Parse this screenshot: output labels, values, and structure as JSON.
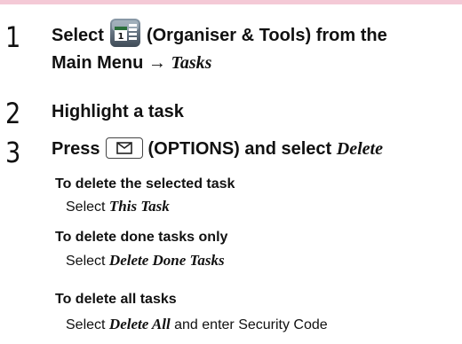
{
  "steps": [
    {
      "number": "1",
      "line1_before": "Select",
      "line1_after": "(Organiser & Tools) from the",
      "line2_prefix": "Main Menu → ",
      "line2_italic": "Tasks"
    },
    {
      "number": "2",
      "text": "Highlight a task"
    },
    {
      "number": "3",
      "before": "Press",
      "after": "(OPTIONS) and select ",
      "italic": "Delete"
    }
  ],
  "options": [
    {
      "heading": "To delete the selected task",
      "body_prefix": "Select ",
      "body_italic": "This Task",
      "body_suffix": ""
    },
    {
      "heading": "To delete done tasks only",
      "body_prefix": "Select ",
      "body_italic": "Delete Done Tasks",
      "body_suffix": ""
    },
    {
      "heading": "To delete all tasks",
      "body_prefix": "Select ",
      "body_italic": "Delete All",
      "body_suffix": " and enter Security Code"
    }
  ],
  "icons": {
    "step1_icon": "organiser-tools-icon",
    "step3_icon": "options-envelope-key-icon"
  },
  "colors": {
    "top_rule": "#f4c9d6"
  }
}
